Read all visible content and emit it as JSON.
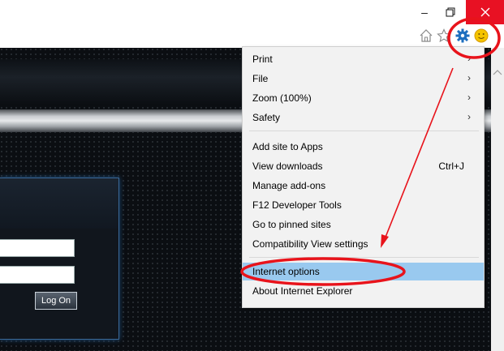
{
  "window": {
    "minimize_label": "–",
    "restore_icon": "restore-icon",
    "close_icon": "close-icon",
    "close_color": "#e81123"
  },
  "toolbar": {
    "icons": [
      "home-icon",
      "star-icon",
      "gear-icon",
      "smiley-icon"
    ],
    "gear_color": "#1f6fbf"
  },
  "login": {
    "logon_label": "Log On"
  },
  "menu": {
    "items": [
      {
        "label": "Print",
        "submenu": true
      },
      {
        "label": "File",
        "submenu": true
      },
      {
        "label": "Zoom (100%)",
        "submenu": true
      },
      {
        "label": "Safety",
        "submenu": true
      },
      {
        "label": "Add site to Apps"
      },
      {
        "label": "View downloads",
        "shortcut": "Ctrl+J"
      },
      {
        "label": "Manage add-ons"
      },
      {
        "label": "F12 Developer Tools"
      },
      {
        "label": "Go to pinned sites"
      },
      {
        "label": "Compatibility View settings"
      },
      {
        "label": "Internet options",
        "highlighted": true
      },
      {
        "label": "About Internet Explorer"
      }
    ],
    "arrow_glyph": "›",
    "highlight_color": "#99c9ef"
  },
  "annotation": {
    "color": "#e8131b"
  }
}
